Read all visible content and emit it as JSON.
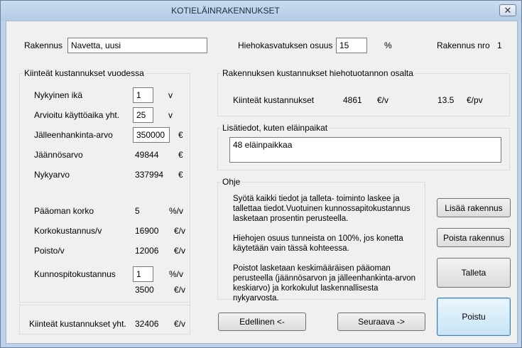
{
  "window": {
    "title": "KOTIELÄINRAKENNUKSET",
    "close_glyph": "✕"
  },
  "header": {
    "building_label": "Rakennus",
    "building_value": "Navetta, uusi",
    "heifer_share_label": "Hiehokasvatuksen osuus",
    "heifer_share_value": "15",
    "heifer_share_unit": "%",
    "building_no_label": "Rakennus nro",
    "building_no_value": "1"
  },
  "fixed_costs": {
    "title": "Kiinteät kustannukset vuodessa",
    "current_age_label": "Nykyinen ikä",
    "current_age_value": "1",
    "current_age_unit": "v",
    "lifetime_label": "Arvioitu käyttöaika yht.",
    "lifetime_value": "25",
    "lifetime_unit": "v",
    "replacement_label": "Jälleenhankinta-arvo",
    "replacement_value": "350000",
    "replacement_unit": "€",
    "residual_label": "Jäännösarvo",
    "residual_value": "49844",
    "residual_unit": "€",
    "present_label": "Nykyarvo",
    "present_value": "337994",
    "present_unit": "€",
    "interest_rate_label": "Pääoman korko",
    "interest_rate_value": "5",
    "interest_rate_unit": "%/v",
    "interest_cost_label": "Korkokustannus/v",
    "interest_cost_value": "16900",
    "interest_cost_unit": "€/v",
    "depreciation_label": "Poisto/v",
    "depreciation_value": "12006",
    "depreciation_unit": "€/v",
    "maintenance_label": "Kunnospitokustannus",
    "maintenance_value": "1",
    "maintenance_unit": "%/v",
    "maintenance_cost_value": "3500",
    "maintenance_cost_unit": "€/v",
    "total_label": "Kiinteät kustannukset  yht.",
    "total_value": "32406",
    "total_unit": "€/v"
  },
  "heifer_costs": {
    "title": "Rakennuksen kustannukset  hiehotuotannon osalta",
    "label": "Kiinteät kustannukset",
    "yearly_value": "4861",
    "yearly_unit": "€/v",
    "daily_value": "13.5",
    "daily_unit": "€/pv"
  },
  "extra_info": {
    "title": "Lisätiedot, kuten eläinpaikat",
    "value": "48 eläinpaikkaa"
  },
  "help": {
    "title": "Ohje",
    "paragraph1": "Syötä kaikki tiedot ja talleta- toiminto laskee ja tallettaa tiedot.Vuotuinen kunnossapitokustannus lasketaan prosentin perusteella.",
    "paragraph2": "Hiehojen osuus tunneista on 100%, jos konetta käytetään vain tässä kohteessa.",
    "paragraph3": "Poistot lasketaan keskimääräisen pääoman perusteella (jäännösarvon ja jälleenhankinta-arvon keskiarvo) ja korkokulut laskennallisesta nykyarvosta."
  },
  "buttons": {
    "add": "Lisää rakennus",
    "remove": "Poista rakennus",
    "save": "Talleta",
    "exit": "Poistu",
    "previous": "Edellinen  <-",
    "next": "Seuraava  ->"
  }
}
